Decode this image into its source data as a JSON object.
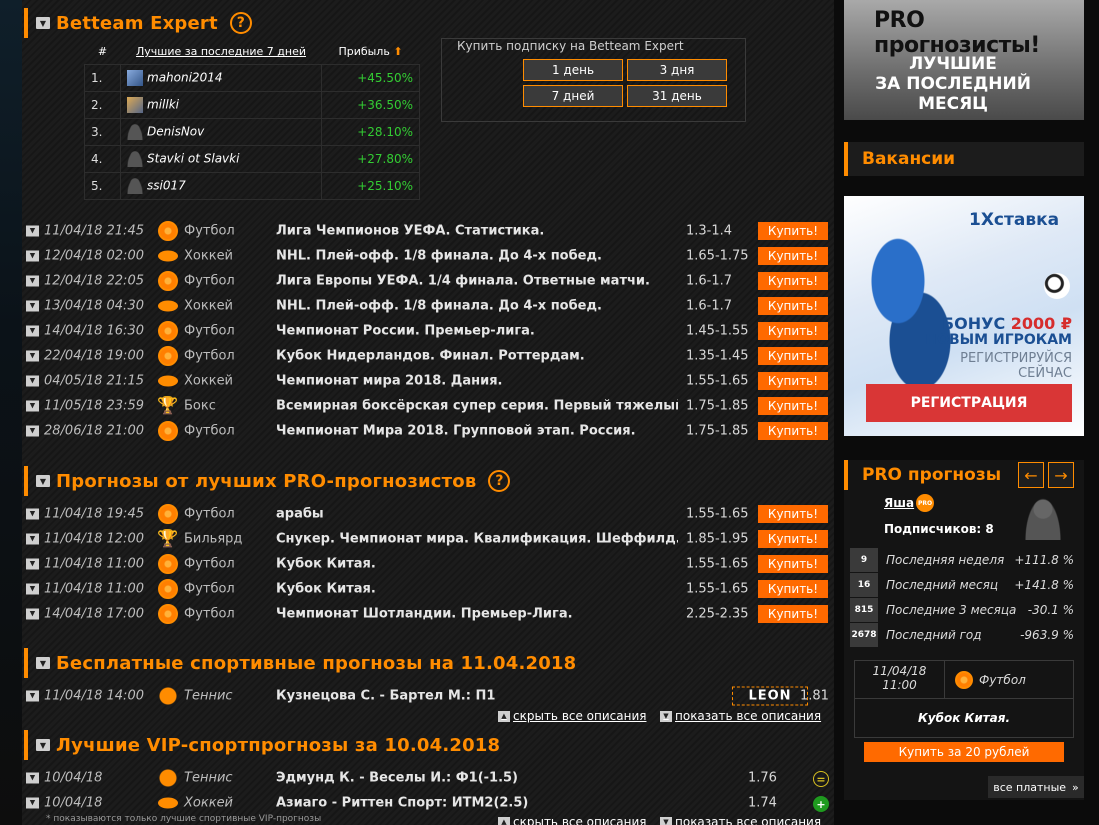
{
  "expert": {
    "title": "Betteam Expert",
    "help": "?",
    "col_num": "#",
    "col_best": "Лучшие за последние 7 дней",
    "col_profit": "Прибыль",
    "rows": [
      {
        "n": "1.",
        "user": "mahoni2014",
        "pct": "+45.50%",
        "avatar": "pic1"
      },
      {
        "n": "2.",
        "user": "millki",
        "pct": "+36.50%",
        "avatar": "pic2"
      },
      {
        "n": "3.",
        "user": "DenisNov",
        "pct": "+28.10%",
        "avatar": "silhouette"
      },
      {
        "n": "4.",
        "user": "Stavki ot Slavki",
        "pct": "+27.80%",
        "avatar": "silhouette"
      },
      {
        "n": "5.",
        "user": "ssi017",
        "pct": "+25.10%",
        "avatar": "silhouette"
      }
    ],
    "subscribe_label": "Купить подписку на Betteam Expert",
    "buttons": [
      "1 день",
      "3 дня",
      "7 дней",
      "31 день"
    ]
  },
  "expert_predictions": [
    {
      "date": "11/04/18 21:45",
      "sport": "Футбол",
      "icon": "soccer-ball-icon",
      "event": "Лига Чемпионов УЕФА. Статистика.",
      "odds": "1.3-1.4",
      "buy": "Купить!"
    },
    {
      "date": "12/04/18 02:00",
      "sport": "Хоккей",
      "icon": "hockey-puck-icon",
      "event": "NHL. Плей-офф. 1/8 финала. До 4-х побед.",
      "odds": "1.65-1.75",
      "buy": "Купить!"
    },
    {
      "date": "12/04/18 22:05",
      "sport": "Футбол",
      "icon": "soccer-ball-icon",
      "event": "Лига Европы УЕФА. 1/4 финала. Ответные матчи.",
      "odds": "1.6-1.7",
      "buy": "Купить!"
    },
    {
      "date": "13/04/18 04:30",
      "sport": "Хоккей",
      "icon": "hockey-puck-icon",
      "event": "NHL. Плей-офф. 1/8 финала. До 4-х побед.",
      "odds": "1.6-1.7",
      "buy": "Купить!"
    },
    {
      "date": "14/04/18 16:30",
      "sport": "Футбол",
      "icon": "soccer-ball-icon",
      "event": "Чемпионат России. Премьер-лига.",
      "odds": "1.45-1.55",
      "buy": "Купить!"
    },
    {
      "date": "22/04/18 19:00",
      "sport": "Футбол",
      "icon": "soccer-ball-icon",
      "event": "Кубок Нидерландов. Финал. Роттердам.",
      "odds": "1.35-1.45",
      "buy": "Купить!"
    },
    {
      "date": "04/05/18 21:15",
      "sport": "Хоккей",
      "icon": "hockey-puck-icon",
      "event": "Чемпионат мира 2018. Дания.",
      "odds": "1.55-1.65",
      "buy": "Купить!"
    },
    {
      "date": "11/05/18 23:59",
      "sport": "Бокс",
      "icon": "trophy-icon",
      "event": "Всемирная боксёрская супер серия. Первый тяжелый ве...",
      "odds": "1.75-1.85",
      "buy": "Купить!"
    },
    {
      "date": "28/06/18 21:00",
      "sport": "Футбол",
      "icon": "soccer-ball-icon",
      "event": "Чемпионат Мира 2018. Групповой этап. Россия.",
      "odds": "1.75-1.85",
      "buy": "Купить!"
    }
  ],
  "pro_section": {
    "title": "Прогнозы от лучших PRO-прогнозистов",
    "help": "?",
    "rows": [
      {
        "date": "11/04/18 19:45",
        "sport": "Футбол",
        "icon": "soccer-ball-icon",
        "event": "арабы",
        "odds": "1.55-1.65",
        "buy": "Купить!"
      },
      {
        "date": "11/04/18 12:00",
        "sport": "Бильярд",
        "icon": "trophy-icon",
        "event": "Снукер. Чемпионат мира. Квалификация. Шеффилд. Мат...",
        "odds": "1.85-1.95",
        "buy": "Купить!"
      },
      {
        "date": "11/04/18 11:00",
        "sport": "Футбол",
        "icon": "soccer-ball-icon",
        "event": "Кубок Китая.",
        "odds": "1.55-1.65",
        "buy": "Купить!"
      },
      {
        "date": "11/04/18 11:00",
        "sport": "Футбол",
        "icon": "soccer-ball-icon",
        "event": "Кубок Китая.",
        "odds": "1.55-1.65",
        "buy": "Купить!"
      },
      {
        "date": "14/04/18 17:00",
        "sport": "Футбол",
        "icon": "soccer-ball-icon",
        "event": "Чемпионат Шотландии. Премьер-Лига.",
        "odds": "2.25-2.35",
        "buy": "Купить!"
      }
    ]
  },
  "free_section": {
    "title": "Бесплатные спортивные прогнозы на 11.04.2018",
    "row": {
      "date": "11/04/18 14:00",
      "sport": "Теннис",
      "event": "Кузнецова С. - Бартел М.: П1",
      "bookmaker": "LEON",
      "odds": "1.81"
    },
    "hide_all": "скрыть все описания",
    "show_all": "показать все описания"
  },
  "vip_section": {
    "title": "Лучшие VIP-спортпрогнозы за 10.04.2018",
    "rows": [
      {
        "date": "10/04/18",
        "sport": "Теннис",
        "icon": "tennis-ball-icon",
        "event": "Эдмунд К. - Веселы И.: Ф1(-1.5)",
        "odds": "1.76"
      },
      {
        "date": "10/04/18",
        "sport": "Хоккей",
        "icon": "hockey-puck-icon",
        "event": "Азиаго - Риттен Спорт: ИТМ2(2.5)",
        "odds": "1.74"
      }
    ],
    "footnote": "* показываются только лучшие спортивные VIP-прогнозы",
    "hide_all": "скрыть все описания",
    "show_all": "показать все описания"
  },
  "sidebar": {
    "banner_line1": "PRO прогнозисты!",
    "banner_line2": "ЛУЧШИЕ",
    "banner_line3": "ЗА ПОСЛЕДНИЙ МЕСЯЦ",
    "vacancies": "Вакансии",
    "ad": {
      "logo": "1Хставка",
      "bonus_prefix": "БОНУС",
      "bonus_sum": "2000 ₽",
      "line2": "НОВЫМ ИГРОКАМ",
      "line3": "РЕГИСТРИРУЙСЯ",
      "line4": "СЕЙЧАС",
      "button": "РЕГИСТРАЦИЯ"
    },
    "pro_title": "PRO прогнозы",
    "tipster": "Яша",
    "tipster_badge": "PRO",
    "subscribers": "Подписчиков: 8",
    "stats": [
      {
        "rank": "9",
        "label": "Последняя неделя",
        "value": "+111.8 %"
      },
      {
        "rank": "16",
        "label": "Последний месяц",
        "value": "+141.8 %"
      },
      {
        "rank": "815",
        "label": "Последние 3 месяца",
        "value": "-30.1 %"
      },
      {
        "rank": "2678",
        "label": "Последний год",
        "value": "-963.9 %"
      }
    ],
    "card": {
      "date": "11/04/18",
      "time": "11:00",
      "sport": "Футбол",
      "event": "Кубок Китая."
    },
    "buy_button": "Купить за 20 рублей",
    "all_paid": "все платные",
    "colors": {
      "accent": "#ff8c00",
      "button": "#ff6a00",
      "positive": "#33cc33"
    }
  }
}
